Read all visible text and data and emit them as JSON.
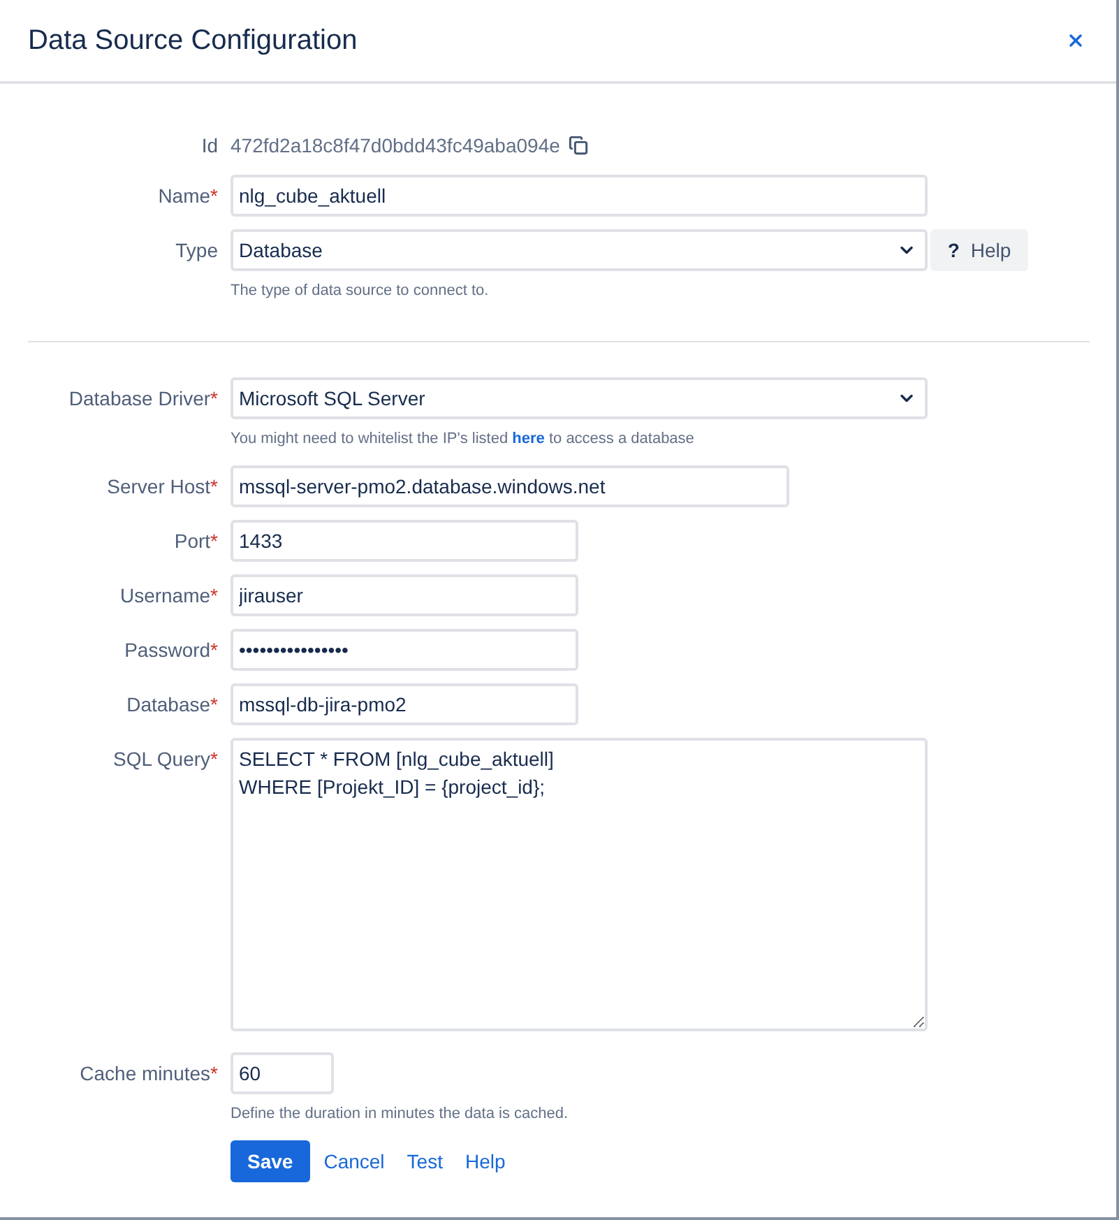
{
  "dialog": {
    "title": "Data Source Configuration"
  },
  "sections": [
    {
      "fields": [
        {
          "kind": "readonly",
          "label": "Id",
          "value": "472fd2a18c8f47d0bdd43fc49aba094e"
        },
        {
          "kind": "text",
          "label": "Name",
          "required_mark": "*",
          "value": "nlg_cube_aktuell"
        },
        {
          "kind": "select",
          "label": "Type",
          "value": "Database",
          "help_button": "**?** Help",
          "hint": [
            {
              "kind": "text",
              "text": "The type of data source to connect to."
            }
          ]
        }
      ]
    },
    {
      "fields": [
        {
          "kind": "select",
          "label": "Database Driver",
          "required_mark": "*",
          "value": "Microsoft SQL Server",
          "hint": [
            {
              "kind": "text",
              "text": "You might need to whitelist the IP's listed "
            },
            {
              "kind": "link",
              "text": "here"
            },
            {
              "kind": "text",
              "text": " to access a database"
            }
          ]
        },
        {
          "kind": "text",
          "label": "Server Host",
          "required_mark": "*",
          "value": "mssql-server-pmo2.database.windows.net"
        },
        {
          "kind": "text",
          "label": "Port",
          "required_mark": "*",
          "value": "1433"
        },
        {
          "kind": "text",
          "label": "Username",
          "required_mark": "*",
          "value": "jirauser"
        },
        {
          "kind": "password",
          "label": "Password",
          "required_mark": "*",
          "value": "••••••••••••••••"
        },
        {
          "kind": "text",
          "label": "Database",
          "required_mark": "*",
          "value": "mssql-db-jira-pmo2"
        },
        {
          "kind": "textarea",
          "label": "SQL Query",
          "required_mark": "*",
          "value": "SELECT * FROM [nlg_cube_aktuell]\nWHERE [Projekt_ID] = {project_id};"
        },
        {
          "kind": "text",
          "label": "Cache minutes",
          "required_mark": "*",
          "value": "60",
          "hint": [
            {
              "kind": "text",
              "text": "Define the duration in minutes the data is cached."
            }
          ]
        }
      ]
    }
  ],
  "actions": [
    {
      "kind": "primary",
      "label": "Save"
    },
    {
      "kind": "link",
      "label": "Cancel"
    },
    {
      "kind": "link",
      "label": "Test"
    },
    {
      "kind": "link",
      "label": "Help"
    }
  ]
}
